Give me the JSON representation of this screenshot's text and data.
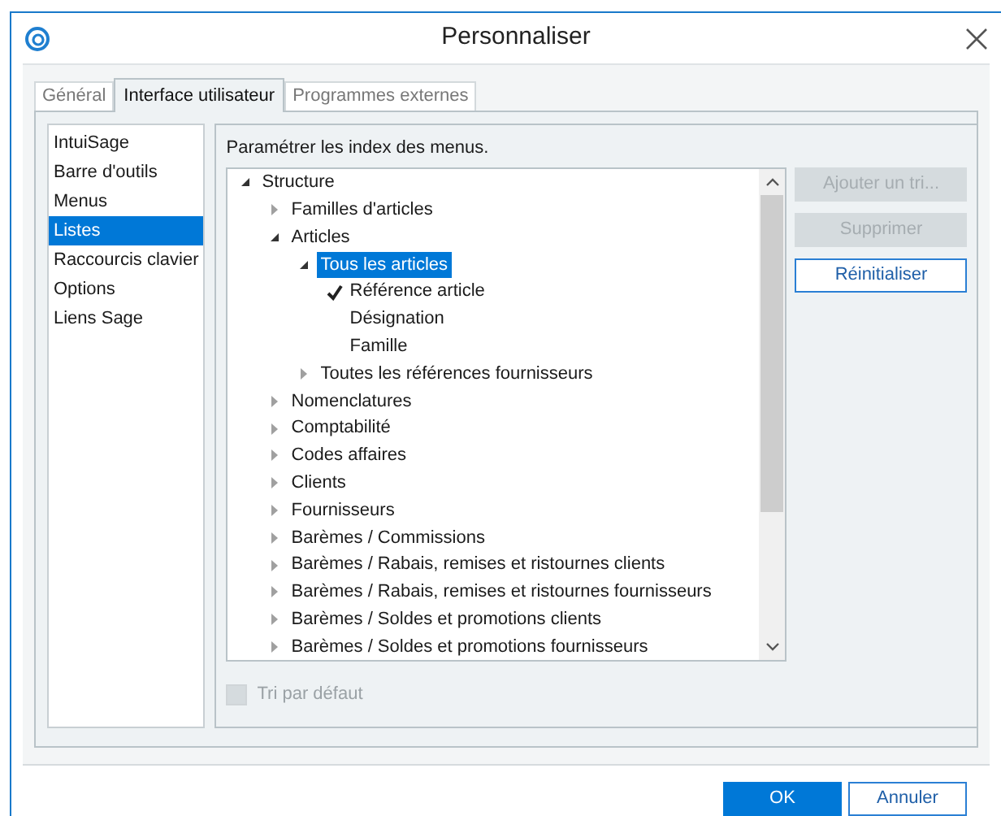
{
  "window": {
    "title": "Personnaliser"
  },
  "tabs": [
    {
      "label": "Général",
      "selected": false
    },
    {
      "label": "Interface utilisateur",
      "selected": true
    },
    {
      "label": "Programmes externes",
      "selected": false
    }
  ],
  "sidebar": {
    "items": [
      {
        "label": "IntuiSage",
        "selected": false
      },
      {
        "label": "Barre d'outils",
        "selected": false
      },
      {
        "label": "Menus",
        "selected": false
      },
      {
        "label": "Listes",
        "selected": true
      },
      {
        "label": "Raccourcis clavier",
        "selected": false
      },
      {
        "label": "Options",
        "selected": false
      },
      {
        "label": "Liens Sage",
        "selected": false
      }
    ]
  },
  "panel": {
    "heading": "Paramétrer les index des menus.",
    "tree": [
      {
        "kind": "node",
        "label": "Structure",
        "expanded": true,
        "selected": false,
        "children": [
          {
            "kind": "node",
            "label": "Familles d'articles",
            "expanded": false,
            "selected": false
          },
          {
            "kind": "node",
            "label": "Articles",
            "expanded": true,
            "selected": false,
            "children": [
              {
                "kind": "node",
                "label": "Tous les articles",
                "expanded": true,
                "selected": true,
                "children": [
                  {
                    "kind": "field",
                    "label": "Référence article",
                    "checked": true
                  },
                  {
                    "kind": "field",
                    "label": "Désignation",
                    "checked": false
                  },
                  {
                    "kind": "field",
                    "label": "Famille",
                    "checked": false
                  }
                ]
              },
              {
                "kind": "node",
                "label": "Toutes les références fournisseurs",
                "expanded": false,
                "selected": false
              }
            ]
          },
          {
            "kind": "node",
            "label": "Nomenclatures",
            "expanded": false,
            "selected": false
          },
          {
            "kind": "node",
            "label": "Comptabilité",
            "expanded": false,
            "selected": false
          },
          {
            "kind": "node",
            "label": "Codes affaires",
            "expanded": false,
            "selected": false
          },
          {
            "kind": "node",
            "label": "Clients",
            "expanded": false,
            "selected": false
          },
          {
            "kind": "node",
            "label": "Fournisseurs",
            "expanded": false,
            "selected": false
          },
          {
            "kind": "node",
            "label": "Barèmes / Commissions",
            "expanded": false,
            "selected": false
          },
          {
            "kind": "node",
            "label": "Barèmes / Rabais, remises et ristournes clients",
            "expanded": false,
            "selected": false
          },
          {
            "kind": "node",
            "label": "Barèmes / Rabais, remises et ristournes fournisseurs",
            "expanded": false,
            "selected": false
          },
          {
            "kind": "node",
            "label": "Barèmes / Soldes et promotions clients",
            "expanded": false,
            "selected": false
          },
          {
            "kind": "node",
            "label": "Barèmes / Soldes et promotions fournisseurs",
            "expanded": false,
            "selected": false
          }
        ]
      }
    ],
    "buttons": [
      {
        "label": "Ajouter un tri...",
        "disabled": true
      },
      {
        "label": "Supprimer",
        "disabled": true
      },
      {
        "label": "Réinitialiser",
        "disabled": false
      }
    ],
    "default_sort": {
      "label": "Tri par défaut",
      "checked": false,
      "disabled": true
    }
  },
  "footer": {
    "buttons": [
      {
        "label": "OK",
        "kind": "primary"
      },
      {
        "label": "Annuler",
        "kind": "secondary"
      }
    ]
  }
}
